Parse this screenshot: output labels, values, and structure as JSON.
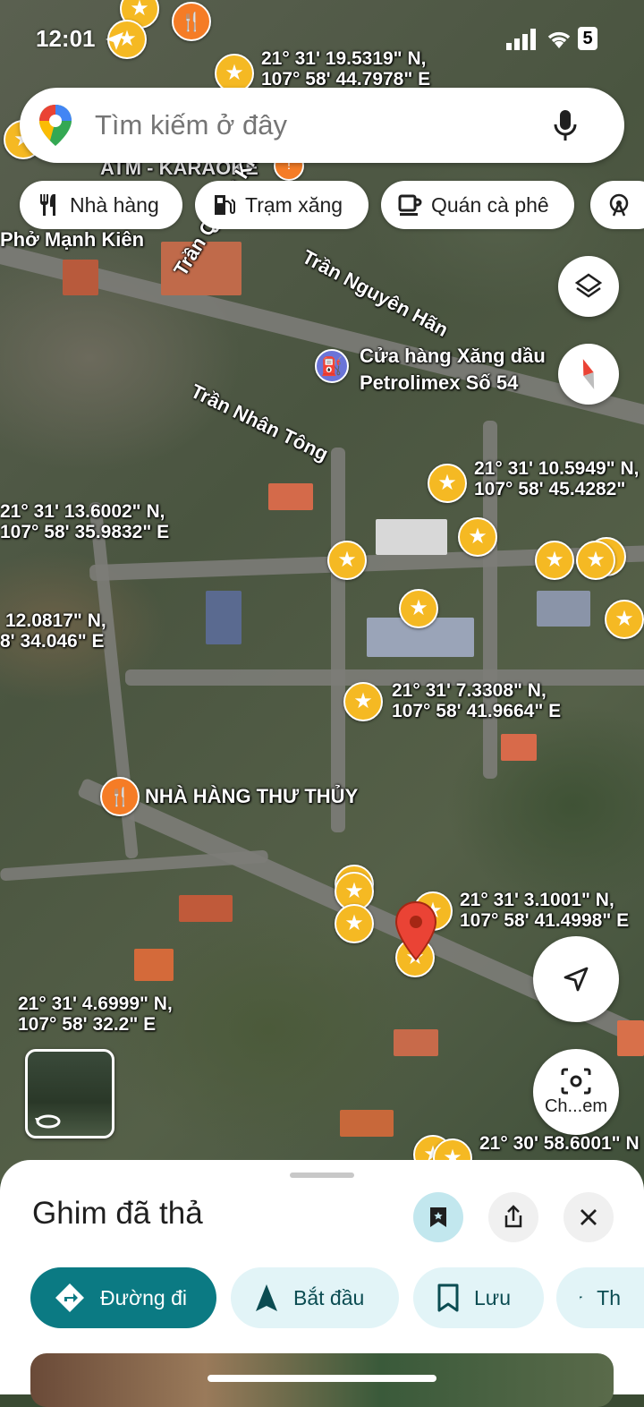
{
  "status_bar": {
    "time": "12:01",
    "network": "5"
  },
  "search": {
    "placeholder": "Tìm kiếm ở đây"
  },
  "chips": [
    {
      "label": "Nhà hàng",
      "icon": "fork-knife-icon"
    },
    {
      "label": "Trạm xăng",
      "icon": "gas-pump-icon"
    },
    {
      "label": "Quán cà phê",
      "icon": "coffee-cup-icon"
    }
  ],
  "map": {
    "street_labels": {
      "tran_quang_khai": "Trần Quang Khải",
      "tran_nguyen_han": "Trần Nguyên Hãn",
      "tran_nhan_tong": "Trần Nhân Tông",
      "pho_manh_kien": "Phở Mạnh Kiên",
      "atm_karaoke": "ATM - KARAOKE"
    },
    "places": {
      "petrolimex_line1": "Cửa hàng Xăng dầu",
      "petrolimex_line2": "Petrolimex Số 54",
      "nha_hang": "NHÀ HÀNG THƯ THỦY"
    },
    "coords": [
      {
        "lat": "21° 31' 19.5319\" N,",
        "lng": "107° 58' 44.7978\" E"
      },
      {
        "lat": "21° 31' 10.5949\" N,",
        "lng": "107° 58' 45.4282\""
      },
      {
        "lat": "21° 31' 13.6002\" N,",
        "lng": "107° 58' 35.9832\" E"
      },
      {
        "lat": "12.0817\" N,",
        "lng": "8' 34.046\" E"
      },
      {
        "lat": "21° 31' 7.3308\" N,",
        "lng": "107° 58' 41.9664\" E"
      },
      {
        "lat": "21° 31' 3.1001\" N,",
        "lng": "107° 58' 41.4998\" E"
      },
      {
        "lat": "21° 31' 4.6999\" N,",
        "lng": "107° 58' 32.2\" E"
      },
      {
        "lat": "21° 30' 58.6001\" N",
        "lng": ""
      }
    ],
    "camera_label": "Ch...em"
  },
  "sheet": {
    "title": "Ghim đã thả",
    "actions": [
      {
        "label": "Đường đi"
      },
      {
        "label": "Bắt đầu"
      },
      {
        "label": "Lưu"
      },
      {
        "label": "Th"
      }
    ]
  },
  "colors": {
    "accent": "#0b7a83",
    "chip_bg": "#e2f4f7",
    "star": "#f5b923",
    "pin": "#ea4335"
  }
}
